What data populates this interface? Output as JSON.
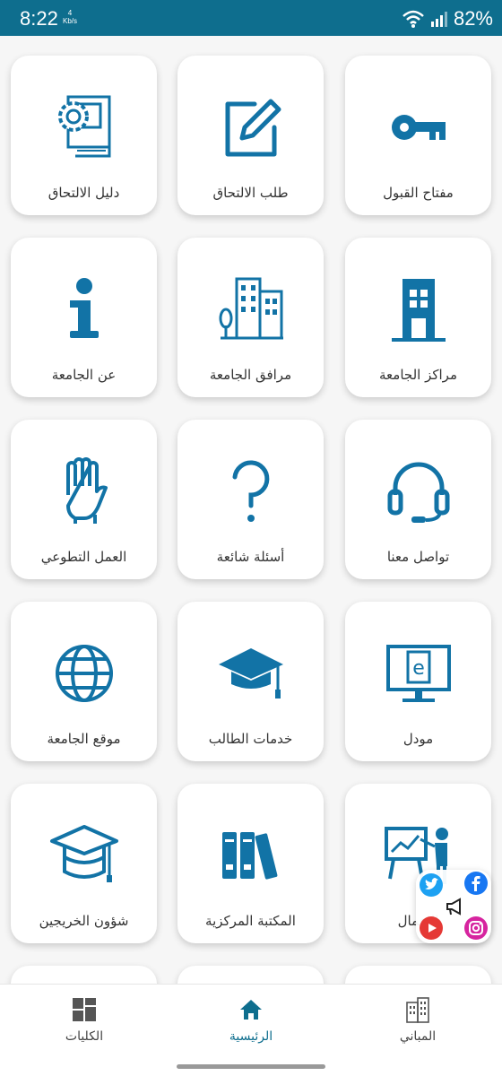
{
  "status_bar": {
    "time": "8:22",
    "speed_value": "4",
    "speed_unit": "Kb/s",
    "battery": "82%"
  },
  "tiles": [
    {
      "label": "مفتاح القبول",
      "icon": "key-icon"
    },
    {
      "label": "طلب الالتحاق",
      "icon": "edit-icon"
    },
    {
      "label": "دليل الالتحاق",
      "icon": "guide-book-icon"
    },
    {
      "label": "مراكز الجامعة",
      "icon": "building-icon"
    },
    {
      "label": "مرافق الجامعة",
      "icon": "facilities-icon"
    },
    {
      "label": "عن الجامعة",
      "icon": "info-icon"
    },
    {
      "label": "تواصل معنا",
      "icon": "headset-icon"
    },
    {
      "label": "أسئلة شائعة",
      "icon": "question-icon"
    },
    {
      "label": "العمل التطوعي",
      "icon": "raised-hand-icon"
    },
    {
      "label": "مودل",
      "icon": "moodle-monitor-icon"
    },
    {
      "label": "خدمات الطالب",
      "icon": "graduation-cap-icon"
    },
    {
      "label": "موقع الجامعة",
      "icon": "globe-icon"
    },
    {
      "label": "الاعمال",
      "icon": "presentation-icon"
    },
    {
      "label": "المكتبة المركزية",
      "icon": "library-books-icon"
    },
    {
      "label": "شؤون الخريجين",
      "icon": "graduate-icon"
    }
  ],
  "bottom_nav": [
    {
      "label": "المباني",
      "icon": "buildings-icon"
    },
    {
      "label": "الرئيسية",
      "icon": "home-icon",
      "active": true
    },
    {
      "label": "الكليات",
      "icon": "grid-icon"
    }
  ],
  "social": {
    "items": [
      "twitter-icon",
      "facebook-icon",
      "youtube-icon",
      "instagram-icon",
      "megaphone-icon"
    ]
  },
  "colors": {
    "primary": "#0e6e8e",
    "icon": "#1273a6"
  }
}
